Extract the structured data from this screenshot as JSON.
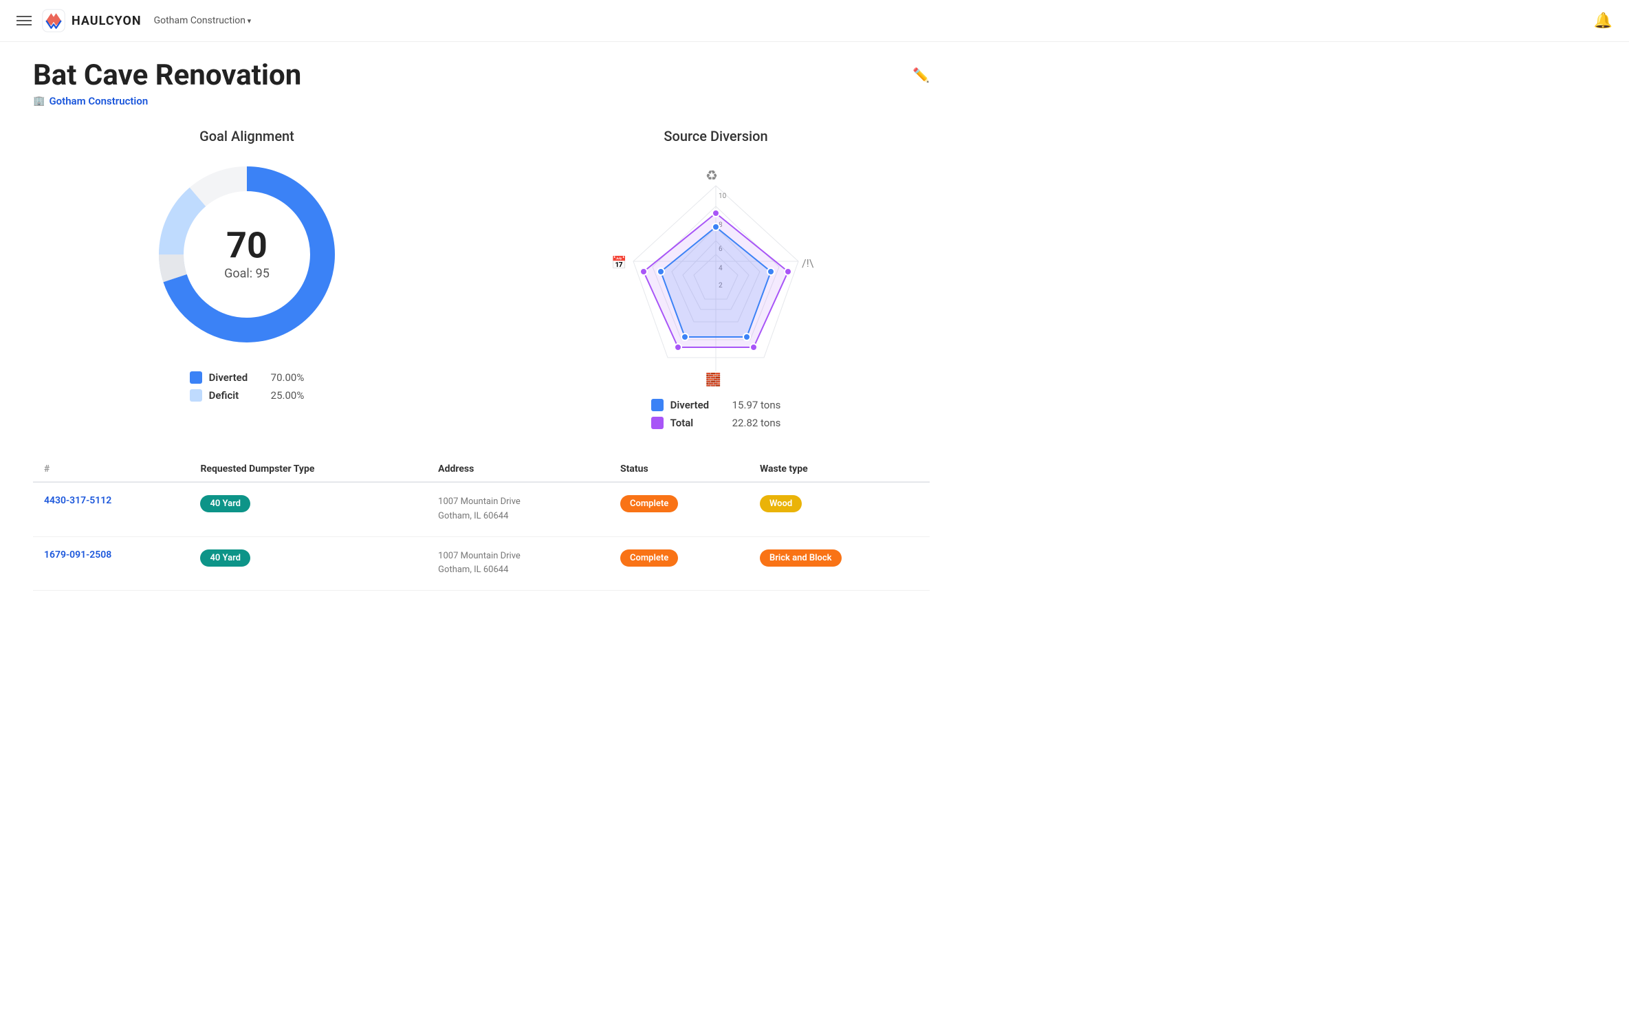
{
  "header": {
    "logo_text": "HAULCYON",
    "company_name": "Gotham Construction",
    "bell_label": "notifications"
  },
  "page": {
    "title": "Bat Cave Renovation",
    "company": "Gotham Construction",
    "edit_label": "edit"
  },
  "goal_alignment": {
    "title": "Goal Alignment",
    "value": "70",
    "goal_label": "Goal: 95",
    "legend": [
      {
        "label": "Diverted",
        "value": "70.00%",
        "color": "#3b82f6"
      },
      {
        "label": "Deficit",
        "value": "25.00%",
        "color": "#bfdbfe"
      }
    ]
  },
  "source_diversion": {
    "title": "Source Diversion",
    "legend": [
      {
        "label": "Diverted",
        "value": "15.97 tons",
        "color": "#3b82f6"
      },
      {
        "label": "Total",
        "value": "22.82 tons",
        "color": "#a855f7"
      }
    ]
  },
  "table": {
    "columns": [
      "#",
      "Requested Dumpster Type",
      "Address",
      "Status",
      "Waste type"
    ],
    "rows": [
      {
        "order_id": "4430-317-5112",
        "dumpster_type": "40 Yard",
        "address_line1": "1007 Mountain Drive",
        "address_line2": "Gotham, IL 60644",
        "status": "Complete",
        "waste_type": "Wood",
        "waste_color": "orange"
      },
      {
        "order_id": "1679-091-2508",
        "dumpster_type": "40 Yard",
        "address_line1": "1007 Mountain Drive",
        "address_line2": "Gotham, IL 60644",
        "status": "Complete",
        "waste_type": "Brick and Block",
        "waste_color": "orange"
      }
    ]
  }
}
